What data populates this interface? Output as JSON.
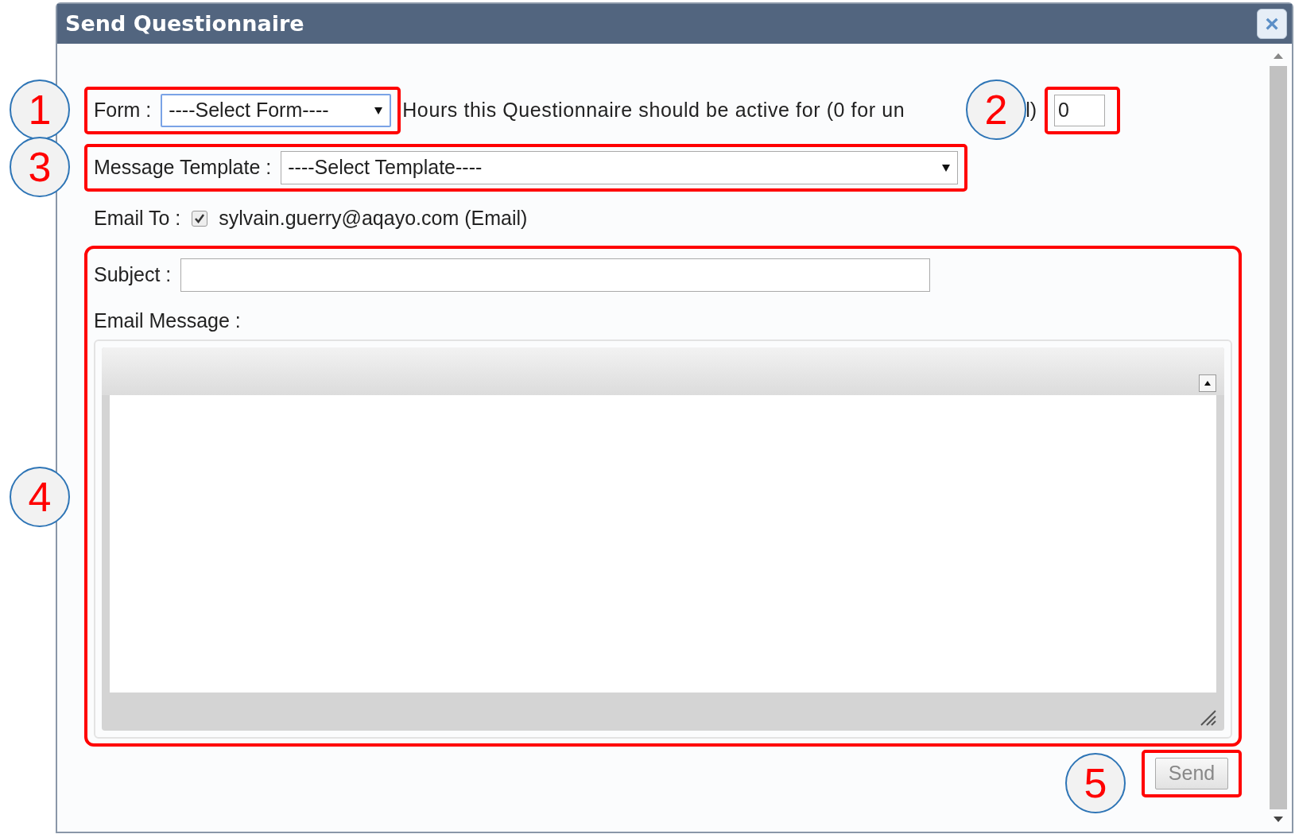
{
  "dialog": {
    "title": "Send Questionnaire",
    "close_label": "×"
  },
  "form_row": {
    "label": "Form :",
    "select_value": "----Select Form----",
    "hours_text": "Hours this Questionnaire should be active for (0 for un",
    "hours_text_after": "l)",
    "hours_value": "0"
  },
  "template_row": {
    "label": "Message Template :",
    "select_value": "----Select Template----"
  },
  "email_to": {
    "label": "Email To :",
    "checked": true,
    "recipient": "sylvain.guerry@aqayo.com (Email)"
  },
  "subject": {
    "label": "Subject :"
  },
  "message": {
    "label": "Email Message :"
  },
  "send_button": {
    "label": "Send",
    "disabled": true
  },
  "callouts": [
    {
      "label": "1"
    },
    {
      "label": "2"
    },
    {
      "label": "3"
    },
    {
      "label": "4"
    },
    {
      "label": "5"
    }
  ]
}
